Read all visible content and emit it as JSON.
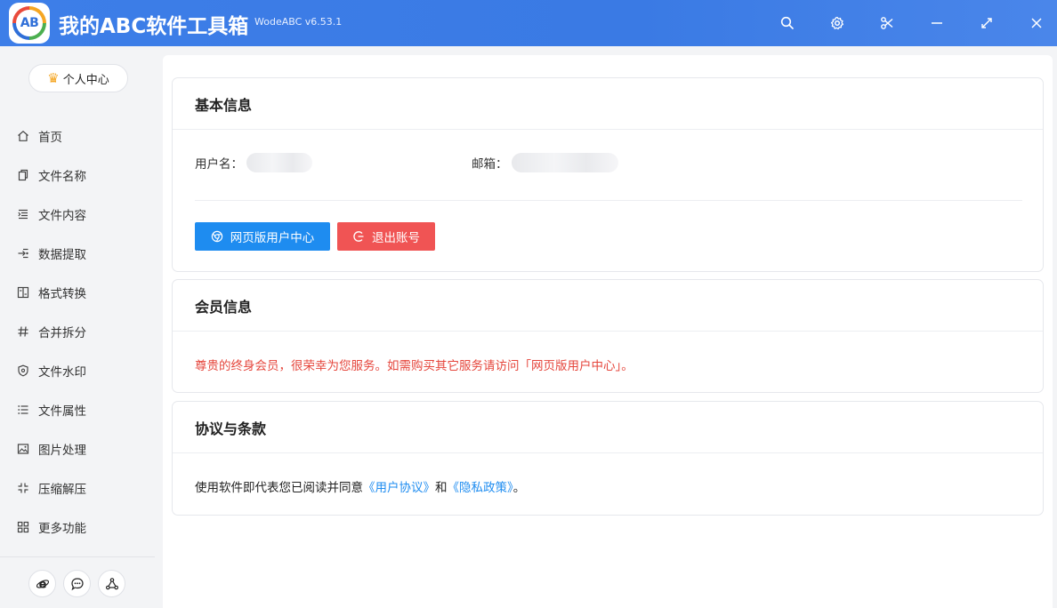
{
  "app": {
    "logo_text": "AB",
    "title": "我的ABC软件工具箱",
    "version": "WodeABC v6.53.1"
  },
  "titlebar_icons": [
    "search-icon",
    "gear-icon",
    "scissors-icon",
    "minimize-icon",
    "maximize-icon",
    "close-icon"
  ],
  "sidebar": {
    "user_center_label": "个人中心",
    "items": [
      {
        "label": "首页",
        "icon": "home-icon"
      },
      {
        "label": "文件名称",
        "icon": "file-copy-icon"
      },
      {
        "label": "文件内容",
        "icon": "indent-list-icon"
      },
      {
        "label": "数据提取",
        "icon": "extract-icon"
      },
      {
        "label": "格式转换",
        "icon": "convert-icon"
      },
      {
        "label": "合并拆分",
        "icon": "hash-icon"
      },
      {
        "label": "文件水印",
        "icon": "shield-icon"
      },
      {
        "label": "文件属性",
        "icon": "list-icon"
      },
      {
        "label": "图片处理",
        "icon": "image-icon"
      },
      {
        "label": "压缩解压",
        "icon": "compress-icon"
      },
      {
        "label": "更多功能",
        "icon": "grid-icon"
      }
    ],
    "bottom_icons": [
      "ie-browser-icon",
      "chat-icon",
      "share-nodes-icon"
    ]
  },
  "basic_info": {
    "title": "基本信息",
    "username_label": "用户名：",
    "email_label": "邮箱：",
    "web_center_button": "网页版用户中心",
    "logout_button": "退出账号"
  },
  "member_info": {
    "title": "会员信息",
    "message": "尊贵的终身会员，很荣幸为您服务。如需购买其它服务请访问「网页版用户中心」。"
  },
  "terms": {
    "title": "协议与条款",
    "prefix": "使用软件即代表您已阅读并同意",
    "user_agreement": "《用户协议》",
    "and": "和",
    "privacy_policy": "《隐私政策》",
    "suffix": "。"
  },
  "colors": {
    "titlebar": "#3d7ee8",
    "primary_button": "#1e8cf0",
    "danger_button": "#f05454",
    "member_text": "#e5463c",
    "link": "#1e8cf0"
  }
}
